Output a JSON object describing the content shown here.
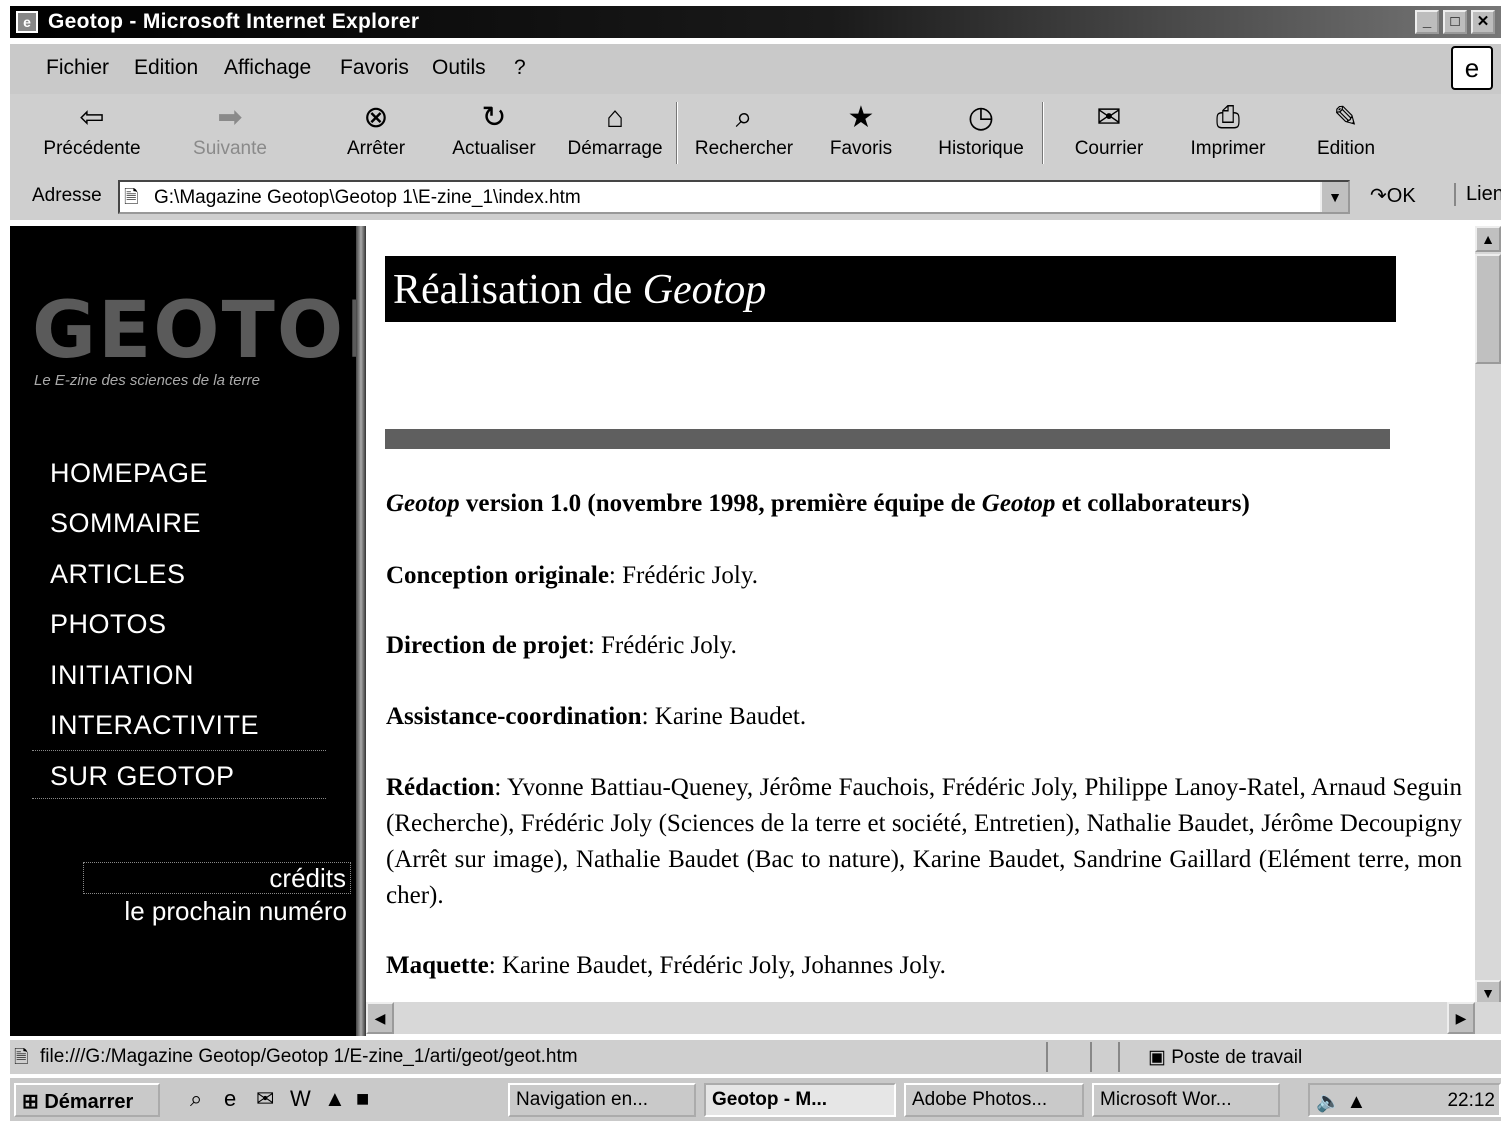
{
  "window": {
    "title": "Geotop - Microsoft Internet Explorer",
    "controls": [
      "_",
      "□",
      "✕"
    ]
  },
  "menu": {
    "items": [
      "Fichier",
      "Edition",
      "Affichage",
      "Favoris",
      "Outils",
      "?"
    ]
  },
  "toolbar": {
    "back": "Précédente",
    "forward": "Suivante",
    "stop": "Arrêter",
    "refresh": "Actualiser",
    "home": "Démarrage",
    "search": "Rechercher",
    "favorites": "Favoris",
    "history": "Historique",
    "mail": "Courrier",
    "print": "Imprimer",
    "edit": "Edition"
  },
  "address": {
    "label": "Adresse",
    "url": "G:\\Magazine Geotop\\Geotop 1\\E-zine_1\\index.htm",
    "go": "OK",
    "links": "Liens"
  },
  "sidebar": {
    "logo": "GEOTOP",
    "tagline": "Le E-zine des sciences de la terre",
    "nav": [
      "HOMEPAGE",
      "SOMMAIRE",
      "ARTICLES",
      "PHOTOS",
      "INITIATION",
      "INTERACTIVITE",
      "SUR GEOTOP"
    ],
    "credits": "crédits",
    "next_issue": "le prochain numéro"
  },
  "content": {
    "banner_prefix": "Réalisation de ",
    "banner_em": "Geotop",
    "version": {
      "em1": "Geotop",
      "text1": " version 1.0 (novembre 1998, première équipe de ",
      "em2": "Geotop",
      "text2": " et collaborateurs)"
    },
    "credits": [
      {
        "label": "Conception originale",
        "value": ": Frédéric Joly."
      },
      {
        "label": "Direction de projet",
        "value": ": Frédéric Joly."
      },
      {
        "label": "Assistance-coordination",
        "value": ": Karine Baudet."
      },
      {
        "label": "Rédaction",
        "value": ": Yvonne Battiau-Queney, Jérôme Fauchois, Frédéric Joly, Philippe Lanoy-Ratel, Arnaud Seguin (Recherche), Frédéric Joly (Sciences de la terre et société, Entretien), Nathalie Baudet, Jérôme Decoupigny (Arrêt sur image), Nathalie Baudet (Bac to nature), Karine Baudet, Sandrine Gaillard (Elément terre, mon cher)."
      },
      {
        "label": "Maquette",
        "value": ": Karine Baudet, Frédéric Joly, Johannes Joly."
      }
    ]
  },
  "status": {
    "text": "file:///G:/Magazine Geotop/Geotop 1/E-zine_1/arti/geot/geot.htm",
    "zone": "Poste de travail"
  },
  "taskbar": {
    "start": "Démarrer",
    "tasks": [
      "Navigation en...",
      "Geotop - M...",
      "Adobe Photos...",
      "Microsoft Wor..."
    ],
    "clock": "22:12"
  }
}
